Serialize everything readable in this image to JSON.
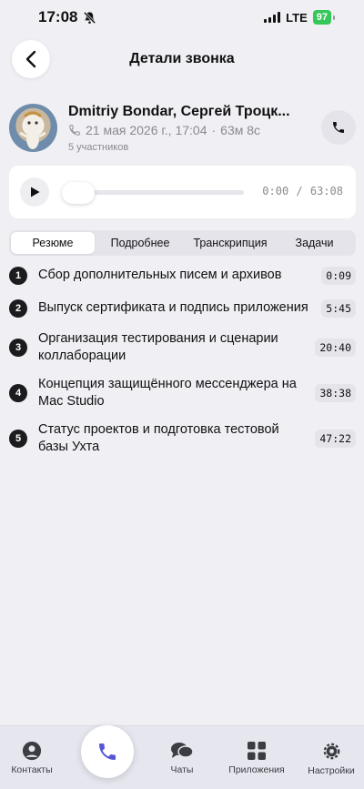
{
  "status_bar": {
    "time": "17:08",
    "network": "LTE",
    "battery": "97"
  },
  "header": {
    "title": "Детали звонка"
  },
  "call": {
    "participants": "Dmitriy Bondar, Сергей Троцк...",
    "date": "21 мая 2026 г., 17:04",
    "separator": "·",
    "duration": "63м 8с",
    "participant_count": "5 участников"
  },
  "player": {
    "current_time": "0:00",
    "divider": "/",
    "total_time": "63:08",
    "progress": 0
  },
  "tabs": [
    "Резюме",
    "Подробнее",
    "Транскрипция",
    "Задачи"
  ],
  "active_tab": "Резюме",
  "topics": [
    {
      "num": "1",
      "text": "Сбор дополнительных писем и архивов",
      "time": "0:09"
    },
    {
      "num": "2",
      "text": "Выпуск сертификата и подпись приложения",
      "time": "5:45"
    },
    {
      "num": "3",
      "text": "Организация тестирования и сценарии коллаборации",
      "time": "20:40"
    },
    {
      "num": "4",
      "text": "Концепция защищённого мессенджера на Mac Studio",
      "time": "38:38"
    },
    {
      "num": "5",
      "text": "Статус проектов и подготовка тестовой базы Ухта",
      "time": "47:22"
    }
  ],
  "tabbar": {
    "contacts": "Контакты",
    "chats": "Чаты",
    "apps": "Приложения",
    "settings": "Настройки"
  },
  "colors": {
    "accent": "#5856d6",
    "battery": "#34c759"
  },
  "icons": [
    "bell-slash-icon",
    "back-chevron-icon",
    "phone-icon",
    "play-icon",
    "person-icon",
    "chat-icon",
    "grid-icon",
    "gear-icon"
  ]
}
